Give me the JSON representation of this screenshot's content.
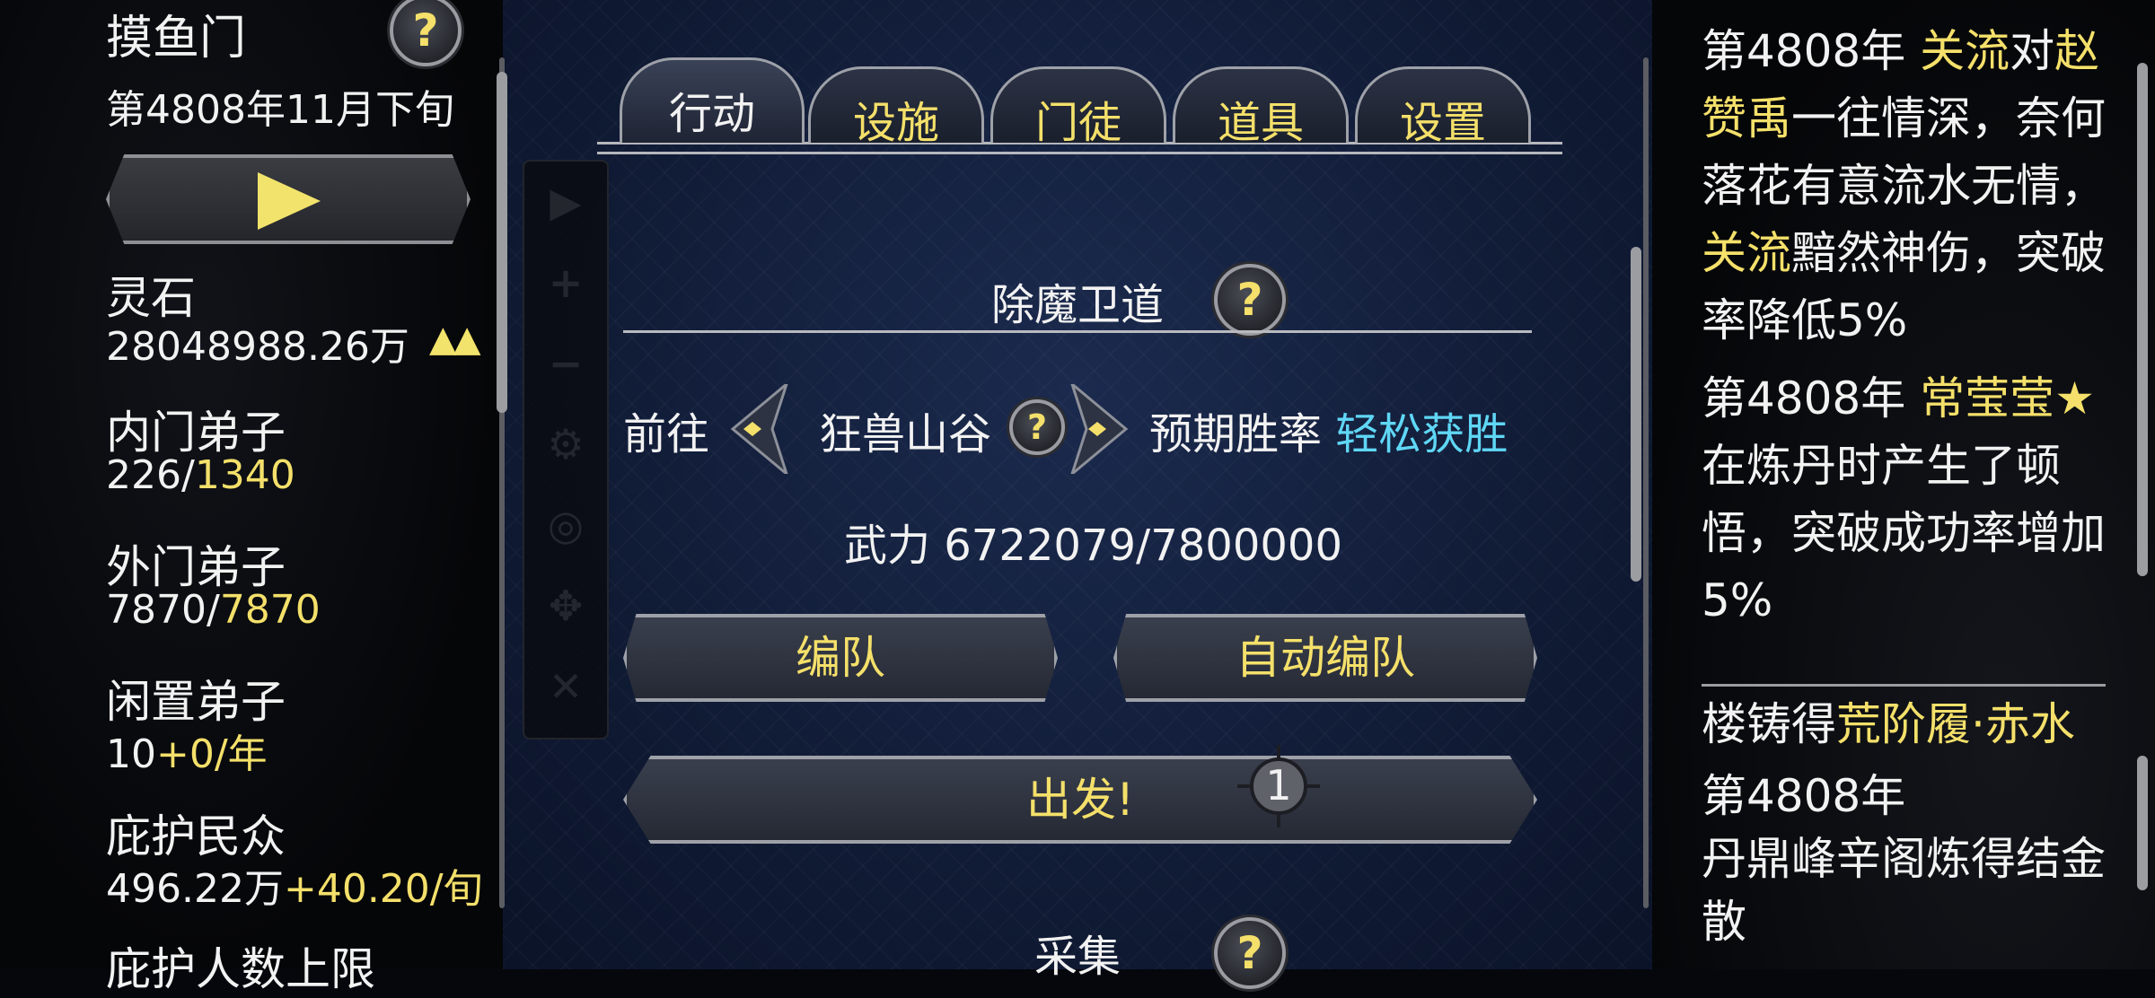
{
  "sect": {
    "name": "摸鱼门",
    "date": "第4808年11月下旬"
  },
  "resources": [
    {
      "label": "灵石",
      "value": "28048988.26万",
      "extra": ""
    },
    {
      "label": "内门弟子",
      "value": "226/",
      "extra": "1340"
    },
    {
      "label": "外门弟子",
      "value": "7870/",
      "extra": "7870"
    },
    {
      "label": "闲置弟子",
      "value": "10",
      "extra": "+0/年"
    },
    {
      "label": "庇护民众",
      "value": "496.22万",
      "extra": "+40.20/旬"
    },
    {
      "label": "庇护人数上限",
      "value": "",
      "extra": ""
    }
  ],
  "warning_glyph": "▲▲",
  "help_glyph": "?",
  "tabs": [
    "行动",
    "设施",
    "门徒",
    "道具",
    "设置"
  ],
  "action": {
    "section_title": "除魔卫道",
    "go_label": "前往",
    "location": "狂兽山谷",
    "winrate_label": "预期胜率",
    "winrate_value": "轻松获胜",
    "power": "武力 6722079/7800000",
    "team_button": "编队",
    "auto_team_button": "自动编队",
    "depart_button": "出发!",
    "badge": "1",
    "next_section": "采集"
  },
  "toolbar_icons": [
    "play-icon",
    "plus-icon",
    "minus-icon",
    "gear-icon",
    "eye-off-icon",
    "move-icon",
    "close-icon"
  ],
  "toolbar_glyphs": [
    "▶",
    "+",
    "−",
    "⚙",
    "◎",
    "✥",
    "✕"
  ],
  "log": {
    "e1_pre": "第4808年 ",
    "e1_name1": "关流",
    "e1_mid": "对",
    "e1_name2": "赵赞禹",
    "e1_text": "一往情深，奈何落花有意流水无情，",
    "e1_name3": "关流",
    "e1_text2": "黯然神伤，突破率降低5%",
    "e2_pre": "第4808年 ",
    "e2_name": "常莹莹★",
    "e2_text": "在炼丹时产生了顿悟，突破成功率增加5%",
    "e3_pre": "楼铸得",
    "e3_item": "荒阶履·赤水",
    "e4_pre": "第4808年",
    "e4_text": "丹鼎峰辛阁炼得结金散"
  },
  "colors": {
    "accent": "#f4e06a",
    "cyan": "#5fd7f5",
    "bg_center": "#101b35"
  }
}
